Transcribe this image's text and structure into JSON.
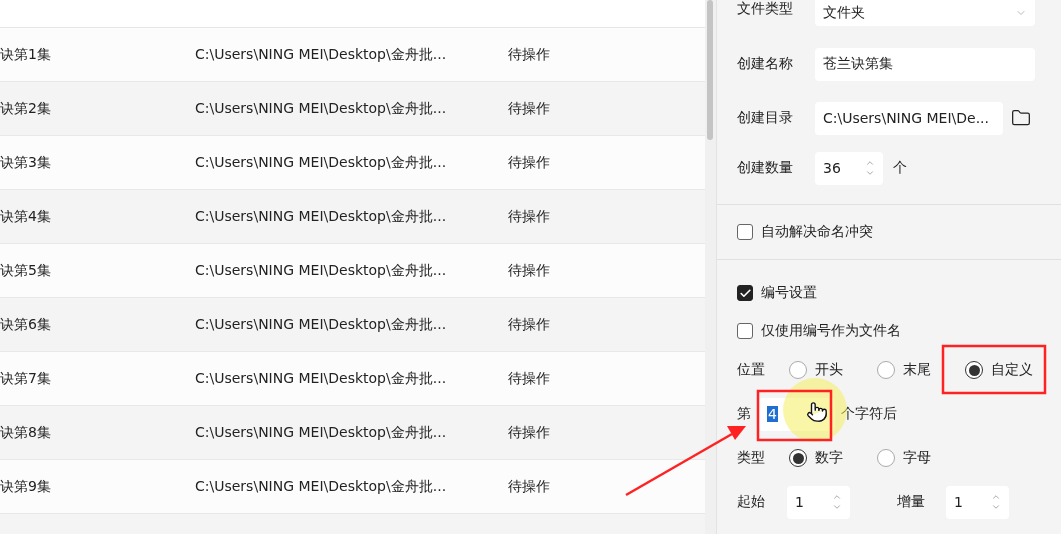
{
  "table": {
    "rows": [
      {
        "name": "诀第1集",
        "path": "C:\\Users\\NING MEI\\Desktop\\金舟批...",
        "status": "待操作"
      },
      {
        "name": "诀第2集",
        "path": "C:\\Users\\NING MEI\\Desktop\\金舟批...",
        "status": "待操作"
      },
      {
        "name": "诀第3集",
        "path": "C:\\Users\\NING MEI\\Desktop\\金舟批...",
        "status": "待操作"
      },
      {
        "name": "诀第4集",
        "path": "C:\\Users\\NING MEI\\Desktop\\金舟批...",
        "status": "待操作"
      },
      {
        "name": "诀第5集",
        "path": "C:\\Users\\NING MEI\\Desktop\\金舟批...",
        "status": "待操作"
      },
      {
        "name": "诀第6集",
        "path": "C:\\Users\\NING MEI\\Desktop\\金舟批...",
        "status": "待操作"
      },
      {
        "name": "诀第7集",
        "path": "C:\\Users\\NING MEI\\Desktop\\金舟批...",
        "status": "待操作"
      },
      {
        "name": "诀第8集",
        "path": "C:\\Users\\NING MEI\\Desktop\\金舟批...",
        "status": "待操作"
      },
      {
        "name": "诀第9集",
        "path": "C:\\Users\\NING MEI\\Desktop\\金舟批...",
        "status": "待操作"
      }
    ]
  },
  "settings": {
    "file_type": {
      "label": "文件类型",
      "value": "文件夹"
    },
    "name": {
      "label": "创建名称",
      "value": "苍兰诀第集"
    },
    "directory": {
      "label": "创建目录",
      "value": "C:\\Users\\NING MEI\\De..."
    },
    "count": {
      "label": "创建数量",
      "value": "36",
      "unit": "个"
    },
    "auto_resolve": {
      "label": "自动解决命名冲突",
      "checked": false
    },
    "numbering": {
      "label": "编号设置",
      "checked": true
    },
    "number_only": {
      "label": "仅使用编号作为文件名",
      "checked": false
    },
    "position": {
      "label": "位置",
      "options": [
        {
          "label": "开头",
          "selected": false
        },
        {
          "label": "末尾",
          "selected": false
        },
        {
          "label": "自定义",
          "selected": true
        }
      ]
    },
    "insert": {
      "prefix": "第",
      "value": "4",
      "suffix": "个字符后"
    },
    "type": {
      "label": "类型",
      "options": [
        {
          "label": "数字",
          "selected": true
        },
        {
          "label": "字母",
          "selected": false
        }
      ]
    },
    "start": {
      "label": "起始",
      "value": "1"
    },
    "increment": {
      "label": "增量",
      "value": "1"
    }
  }
}
